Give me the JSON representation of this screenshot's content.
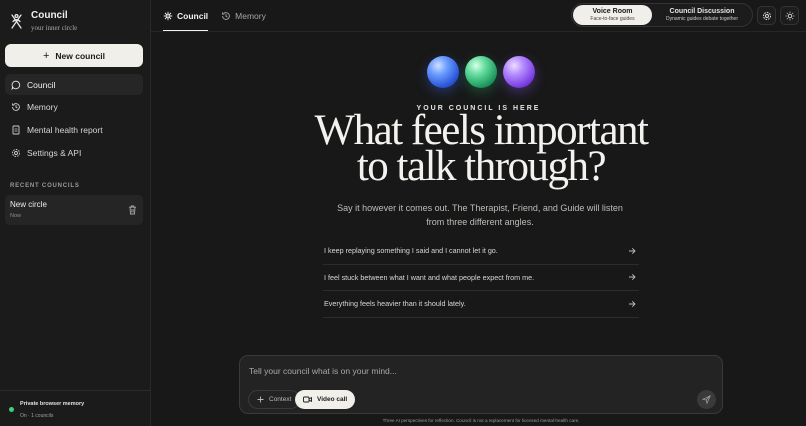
{
  "app": {
    "title": "Council",
    "subtitle": "your inner circle"
  },
  "sidebar": {
    "new_council_label": "New council",
    "items": [
      {
        "label": "Council",
        "icon": "chat-bubble-icon",
        "active": true
      },
      {
        "label": "Memory",
        "icon": "history-icon",
        "active": false
      },
      {
        "label": "Mental health report",
        "icon": "report-icon",
        "active": false
      },
      {
        "label": "Settings & API",
        "icon": "gear-icon",
        "active": false
      }
    ],
    "recent_title": "RECENT COUNCILS",
    "recent": [
      {
        "name": "New circle",
        "time": "Now"
      }
    ],
    "footer": {
      "title": "Private browser memory",
      "status": "On · 1 councils",
      "status_color": "#3fcf7a"
    }
  },
  "header": {
    "tabs": [
      {
        "label": "Council",
        "icon": "sparkle-icon",
        "active": true
      },
      {
        "label": "Memory",
        "icon": "history-icon",
        "active": false
      }
    ],
    "modes": [
      {
        "title": "Voice Room",
        "subtitle": "Face-to-face guides",
        "selected": true
      },
      {
        "title": "Council Discussion",
        "subtitle": "Dynamic guides debate together",
        "selected": false
      }
    ]
  },
  "hero": {
    "orbs": [
      "blue",
      "green",
      "purple"
    ],
    "eyebrow": "YOUR COUNCIL IS HERE",
    "headline_line1": "What feels important",
    "headline_line2": "to talk through?",
    "subtext": "Say it however it comes out. The Therapist, Friend, and Guide will listen from three different angles."
  },
  "prompts": [
    "I keep replaying something I said and I cannot let it go.",
    "I feel stuck between what I want and what people expect from me.",
    "Everything feels heavier than it should lately."
  ],
  "composer": {
    "placeholder": "Tell your council what is on your mind...",
    "context_label": "Context",
    "video_label": "Video call"
  },
  "disclaimer": "Three AI perspectives for reflection. Council is not a replacement for licensed mental-health care.",
  "colors": {
    "accent_light": "#f1efea",
    "background": "#181818",
    "status_green": "#3fcf7a"
  }
}
